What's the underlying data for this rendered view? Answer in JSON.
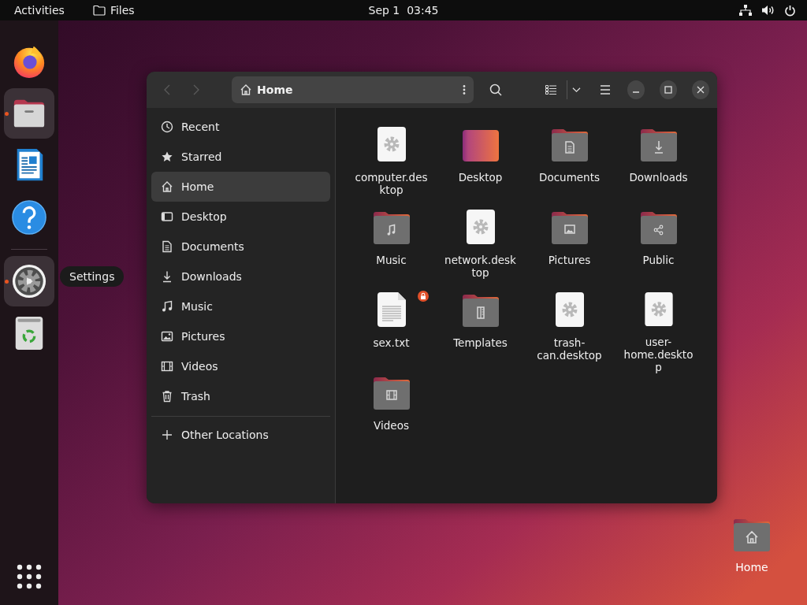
{
  "top_bar": {
    "activities": "Activities",
    "app_name": "Files",
    "clock": "Sep 1  03:45"
  },
  "dock": {
    "favorites": [
      {
        "kind": "firefox",
        "running": false,
        "highlighted": false
      },
      {
        "kind": "files",
        "running": true,
        "highlighted": true
      },
      {
        "kind": "writer",
        "running": false,
        "highlighted": false
      },
      {
        "kind": "help",
        "running": false,
        "highlighted": false
      }
    ],
    "others": [
      {
        "kind": "settings",
        "running": true,
        "highlighted": true,
        "tooltip": "Settings"
      },
      {
        "kind": "trash",
        "running": false,
        "highlighted": false
      }
    ]
  },
  "window": {
    "path": "Home",
    "sidebar": {
      "items": [
        {
          "kind": "recent",
          "label": "Recent",
          "selected": false
        },
        {
          "kind": "starred",
          "label": "Starred",
          "selected": false
        },
        {
          "kind": "home",
          "label": "Home",
          "selected": true
        },
        {
          "kind": "desktop",
          "label": "Desktop",
          "selected": false
        },
        {
          "kind": "documents",
          "label": "Documents",
          "selected": false
        },
        {
          "kind": "downloads",
          "label": "Downloads",
          "selected": false
        },
        {
          "kind": "music",
          "label": "Music",
          "selected": false
        },
        {
          "kind": "pictures",
          "label": "Pictures",
          "selected": false
        },
        {
          "kind": "videos",
          "label": "Videos",
          "selected": false
        },
        {
          "kind": "trash",
          "label": "Trash",
          "selected": false
        }
      ],
      "other_locations": "Other Locations"
    },
    "files": [
      {
        "kind": "desktop-file",
        "name": "computer.desktop",
        "locked": false
      },
      {
        "kind": "folder-desktop",
        "name": "Desktop",
        "locked": false
      },
      {
        "kind": "folder-documents",
        "name": "Documents",
        "locked": false
      },
      {
        "kind": "folder-downloads",
        "name": "Downloads",
        "locked": false
      },
      {
        "kind": "folder-music",
        "name": "Music",
        "locked": false
      },
      {
        "kind": "desktop-file",
        "name": "network.desktop",
        "locked": false
      },
      {
        "kind": "folder-pictures",
        "name": "Pictures",
        "locked": false
      },
      {
        "kind": "folder-public",
        "name": "Public",
        "locked": false
      },
      {
        "kind": "text-file",
        "name": "sex.txt",
        "locked": true
      },
      {
        "kind": "folder-templates",
        "name": "Templates",
        "locked": false
      },
      {
        "kind": "desktop-file",
        "name": "trash-can.desktop",
        "locked": false
      },
      {
        "kind": "desktop-file",
        "name": "user-home.desktop",
        "locked": false
      },
      {
        "kind": "folder-videos",
        "name": "Videos",
        "locked": false
      }
    ]
  },
  "desktop_icons": [
    {
      "kind": "folder-home",
      "name": "Home"
    }
  ]
}
